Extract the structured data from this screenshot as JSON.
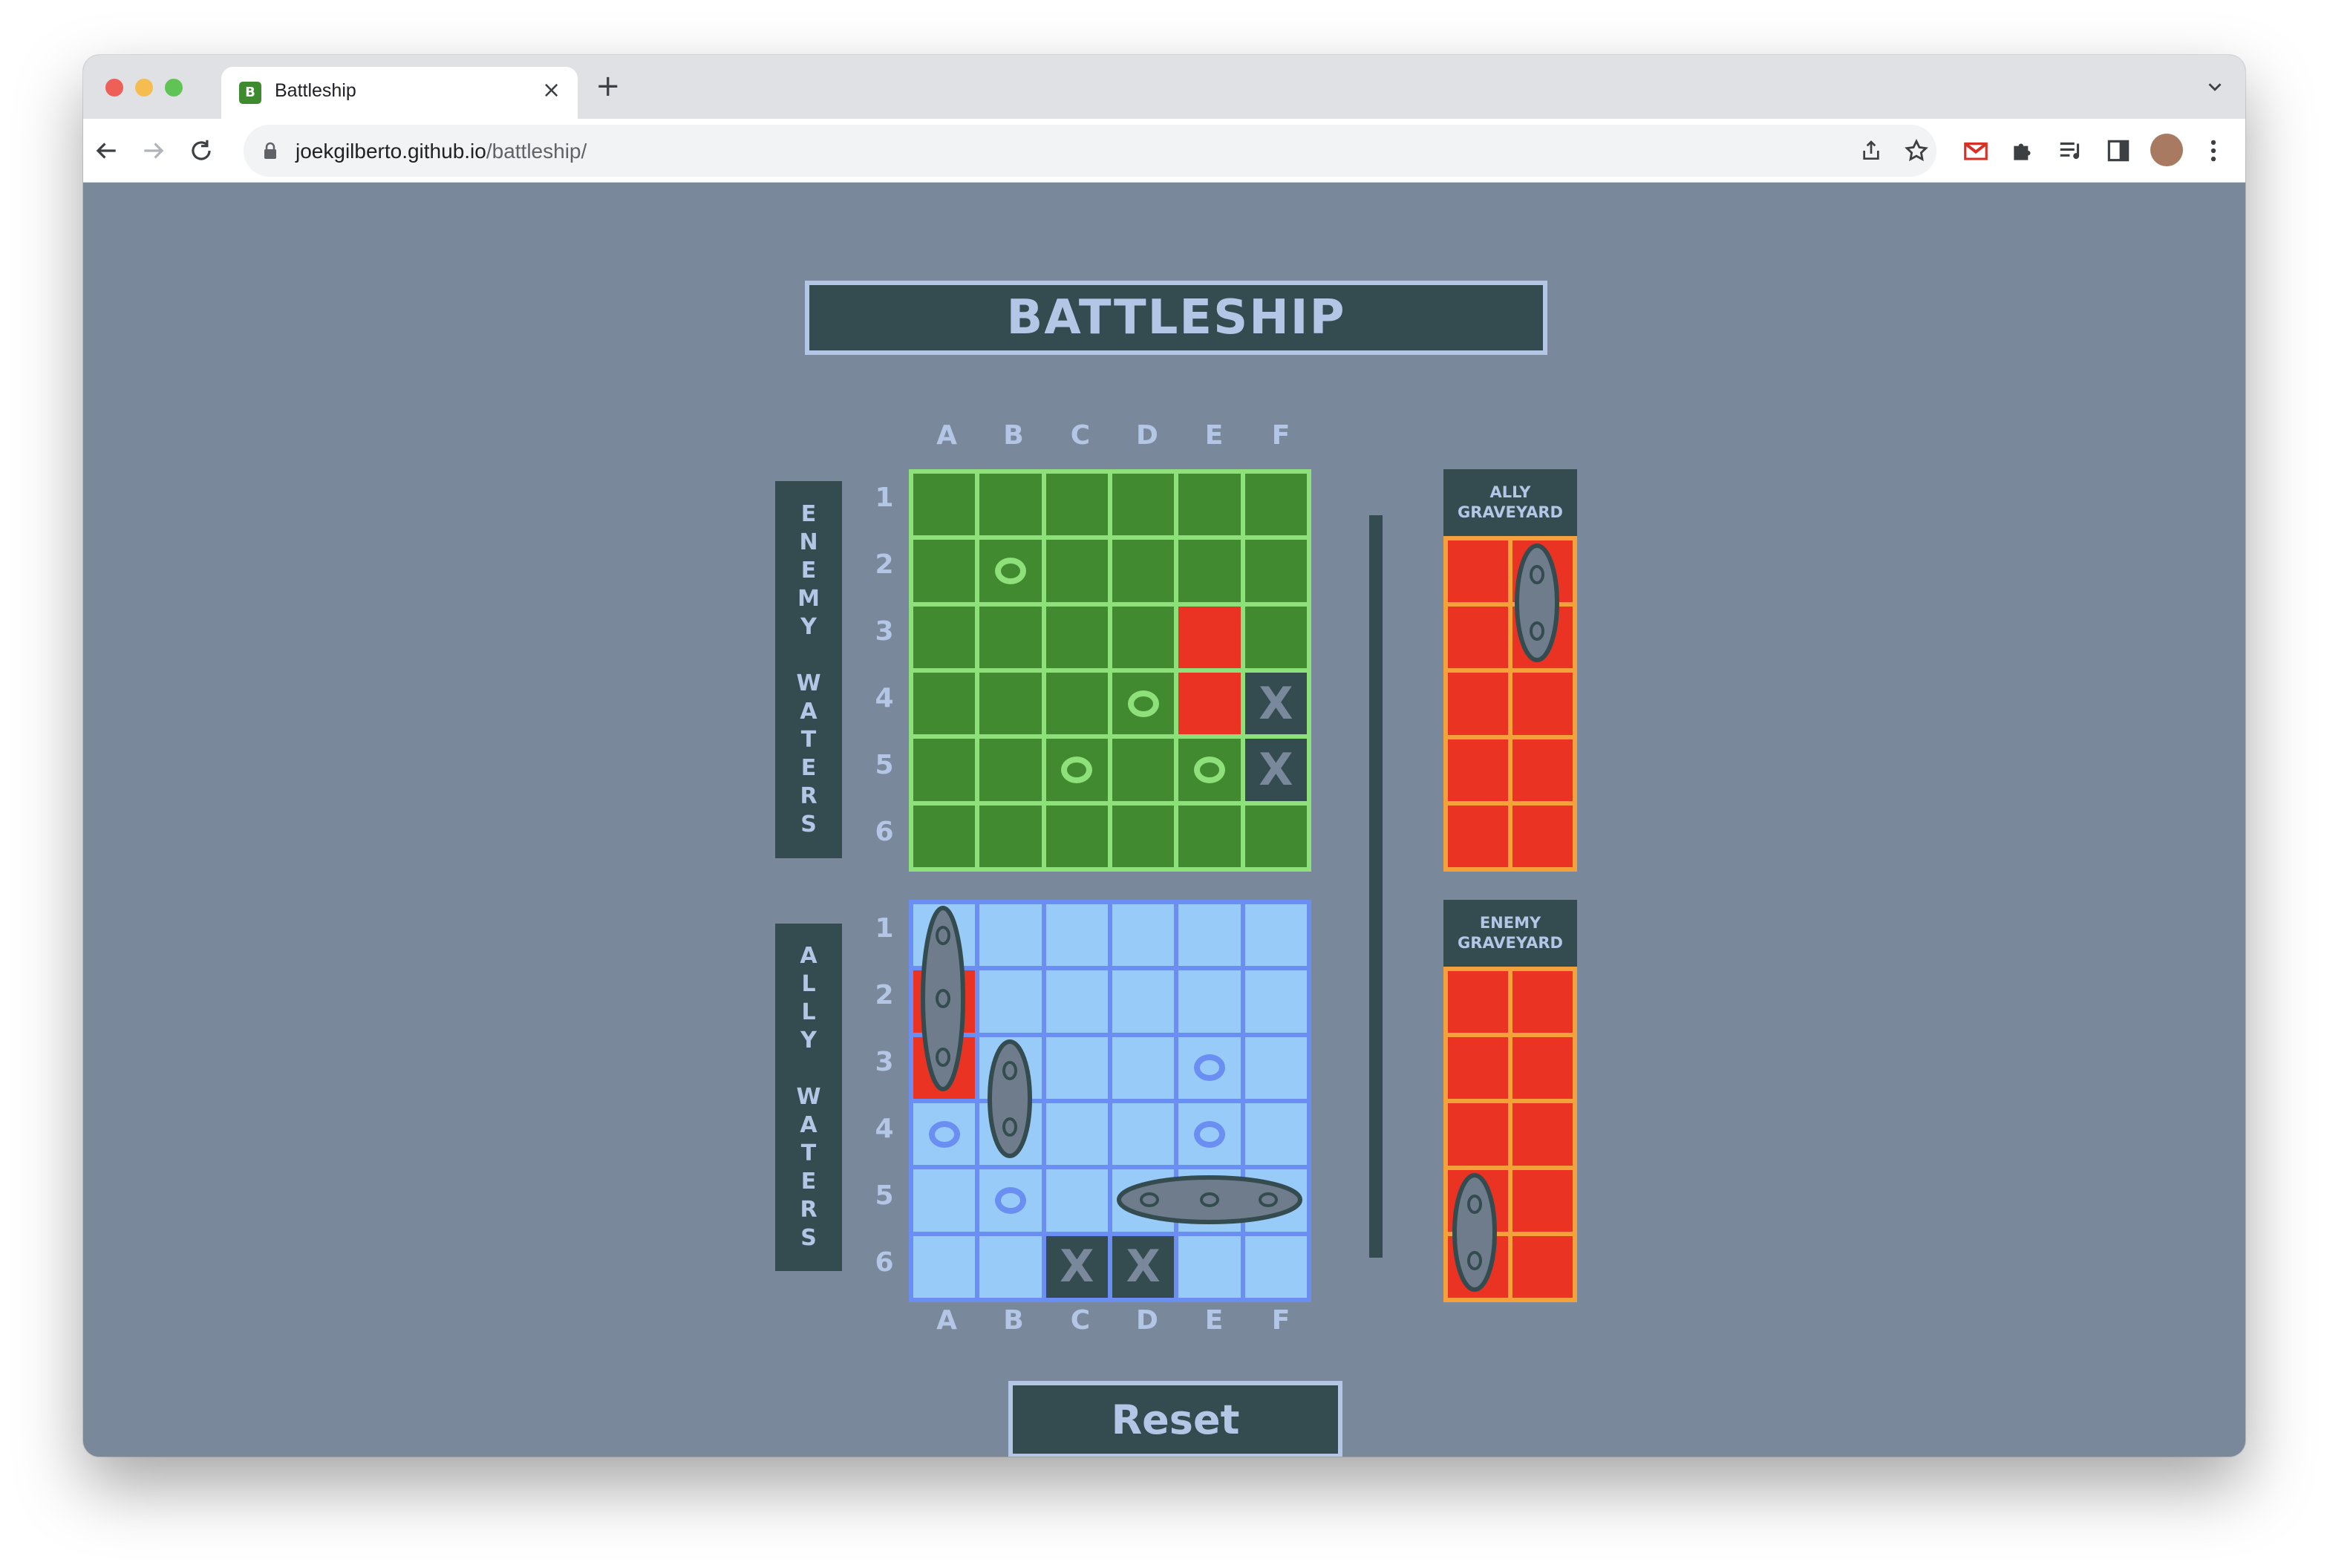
{
  "browser": {
    "tab_title": "Battleship",
    "favicon_letter": "B",
    "tab_close": "×",
    "new_tab": "+",
    "url_host": "joekgilberto.github.io",
    "url_path": "/battleship/"
  },
  "game": {
    "title": "BATTLESHIP",
    "columns": [
      "A",
      "B",
      "C",
      "D",
      "E",
      "F"
    ],
    "rows": [
      "1",
      "2",
      "3",
      "4",
      "5",
      "6"
    ],
    "enemy_label": [
      "E",
      "N",
      "E",
      "M",
      "Y",
      "",
      "W",
      "A",
      "T",
      "E",
      "R",
      "S"
    ],
    "ally_label": [
      "A",
      "L",
      "L",
      "Y",
      "",
      "W",
      "A",
      "T",
      "E",
      "R",
      "S"
    ],
    "enemy_board": [
      [
        "",
        "",
        "",
        "",
        "",
        ""
      ],
      [
        "",
        "O",
        "",
        "",
        "",
        ""
      ],
      [
        "",
        "",
        "",
        "",
        "hit",
        ""
      ],
      [
        "",
        "",
        "",
        "O",
        "hit",
        "X"
      ],
      [
        "",
        "",
        "O",
        "",
        "O",
        "X"
      ],
      [
        "",
        "",
        "",
        "",
        "",
        ""
      ]
    ],
    "ally_board": [
      [
        "",
        "",
        "",
        "",
        "",
        ""
      ],
      [
        "hit",
        "",
        "",
        "",
        "",
        ""
      ],
      [
        "hit",
        "",
        "",
        "",
        "O",
        ""
      ],
      [
        "O",
        "",
        "",
        "",
        "O",
        ""
      ],
      [
        "",
        "O",
        "",
        "",
        "",
        ""
      ],
      [
        "",
        "",
        "X",
        "X",
        "",
        ""
      ]
    ],
    "ally_graveyard": [
      "ALLY",
      "GRAVEYARD"
    ],
    "enemy_graveyard": [
      "ENEMY",
      "GRAVEYARD"
    ],
    "reset_label": "Reset",
    "miss_symbol": "O",
    "sunk_symbol": "X"
  },
  "colors": {
    "page_bg": "#79889a",
    "panel_dark": "#344c50",
    "label_light": "#b3c6e6",
    "enemy_water": "#418a2f",
    "enemy_grid_line": "#8ee07a",
    "ally_water": "#99cbf8",
    "ally_grid_line": "#6a8ef2",
    "hit_red": "#ea3323",
    "graveyard_border": "#f4a13b",
    "ship_fill": "#6f7c8c"
  }
}
